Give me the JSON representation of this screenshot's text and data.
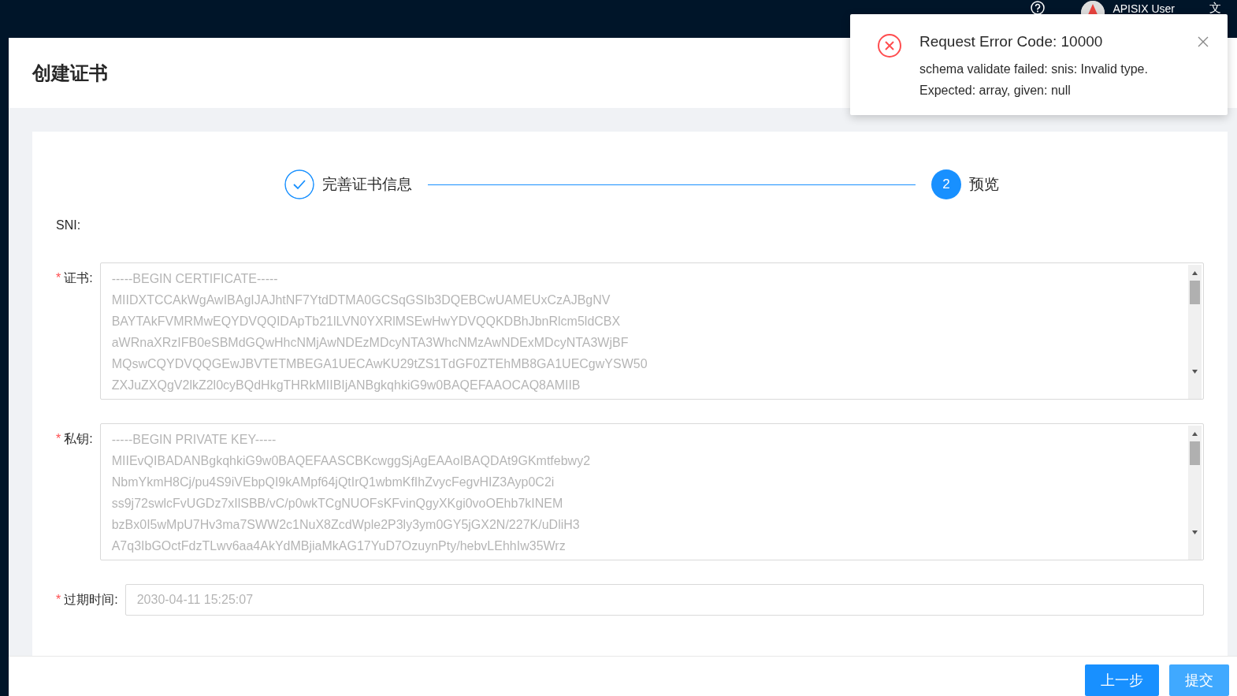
{
  "header": {
    "user_name": "APISIX User",
    "language_icon": "文"
  },
  "page_title": "创建证书",
  "steps": [
    {
      "title": "完善证书信息",
      "completed": true
    },
    {
      "title": "预览",
      "number": "2",
      "completed": false
    }
  ],
  "form": {
    "sni_label": "SNI:",
    "fields": [
      {
        "kind": "textarea",
        "label": "证书:",
        "required_mark": "*",
        "disabled": true,
        "lines": [
          "-----BEGIN CERTIFICATE-----",
          "MIIDXTCCAkWgAwIBAgIJAJhtNF7YtdDTMA0GCSqGSIb3DQEBCwUAMEUxCzAJBgNV",
          "BAYTAkFVMRMwEQYDVQQIDApTb21lLVN0YXRlMSEwHwYDVQQKDBhJbnRlcm5ldCBX",
          "aWRnaXRzIFB0eSBMdGQwHhcNMjAwNDEzMDcyNTA3WhcNMzAwNDExMDcyNTA3WjBF",
          "MQswCQYDVQQGEwJBVTETMBEGA1UECAwKU29tZS1TdGF0ZTEhMB8GA1UECgwYSW50",
          "ZXJuZXQgV2lkZ2l0cyBQdHkgTHRkMIIBIjANBgkqhkiG9w0BAQEFAAOCAQ8AMIIB"
        ]
      },
      {
        "kind": "textarea",
        "label": "私钥:",
        "required_mark": "*",
        "disabled": true,
        "lines": [
          "-----BEGIN PRIVATE KEY-----",
          "MIIEvQIBADANBgkqhkiG9w0BAQEFAASCBKcwggSjAgEAAoIBAQDAt9GKmtfebwy2",
          "NbmYkmH8Cj/pu4S9iVEbpQI9kAMpf64jQtIrQ1wbmKfIhZvycFegvHIZ3Ayp0C2i",
          "ss9j72swlcFvUGDz7xIlSBB/vC/p0wkTCgNUOFsKFvinQgyXKgi0voOEhb7kINEM",
          "bzBx0I5wMpU7Hv3ma7SWW2c1NuX8ZcdWple2P3ly3ym0GY5jGX2N/227K/uDliH3",
          "A7q3IbGOctFdzTLwv6aa4AkYdMBjiaMkAG17YuD7OzuynPty/hebvLEhhIw35Wrz"
        ]
      },
      {
        "kind": "input",
        "label": "过期时间:",
        "required_mark": "*",
        "disabled": true,
        "value": "2030-04-11 15:25:07"
      }
    ]
  },
  "footer": {
    "buttons": [
      {
        "label": "上一步",
        "disabled": false
      },
      {
        "label": "提交",
        "disabled": true
      }
    ]
  },
  "notification": {
    "title": "Request Error Code: 10000",
    "message": "schema validate failed: snis: Invalid type. Expected: array, given: null"
  }
}
